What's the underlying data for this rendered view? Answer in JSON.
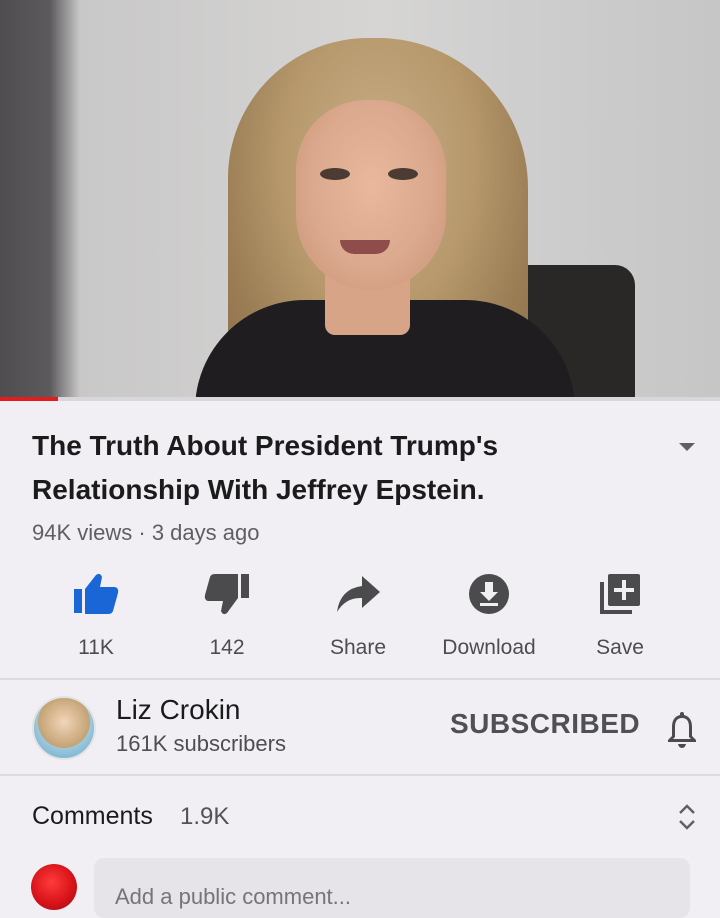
{
  "player": {
    "progress_fraction": 0.08,
    "accent_color": "#e01e1e"
  },
  "video": {
    "title": "The Truth About President Trump's Relationship With Jeffrey Epstein.",
    "meta": "94K views · 3 days ago"
  },
  "actions": [
    {
      "icon": "thumbs-up-icon",
      "label": "11K",
      "color": "#1a66d6"
    },
    {
      "icon": "thumbs-down-icon",
      "label": "142"
    },
    {
      "icon": "share-icon",
      "label": "Share"
    },
    {
      "icon": "download-icon",
      "label": "Download"
    },
    {
      "icon": "save-playlist-icon",
      "label": "Save"
    }
  ],
  "channel": {
    "name": "Liz Crokin",
    "subscribers": "161K subscribers",
    "subscribe_label": "SUBSCRIBED",
    "bell_icon": "bell-icon"
  },
  "comments": {
    "label": "Comments",
    "count": "1.9K",
    "placeholder": "Add a public comment..."
  }
}
